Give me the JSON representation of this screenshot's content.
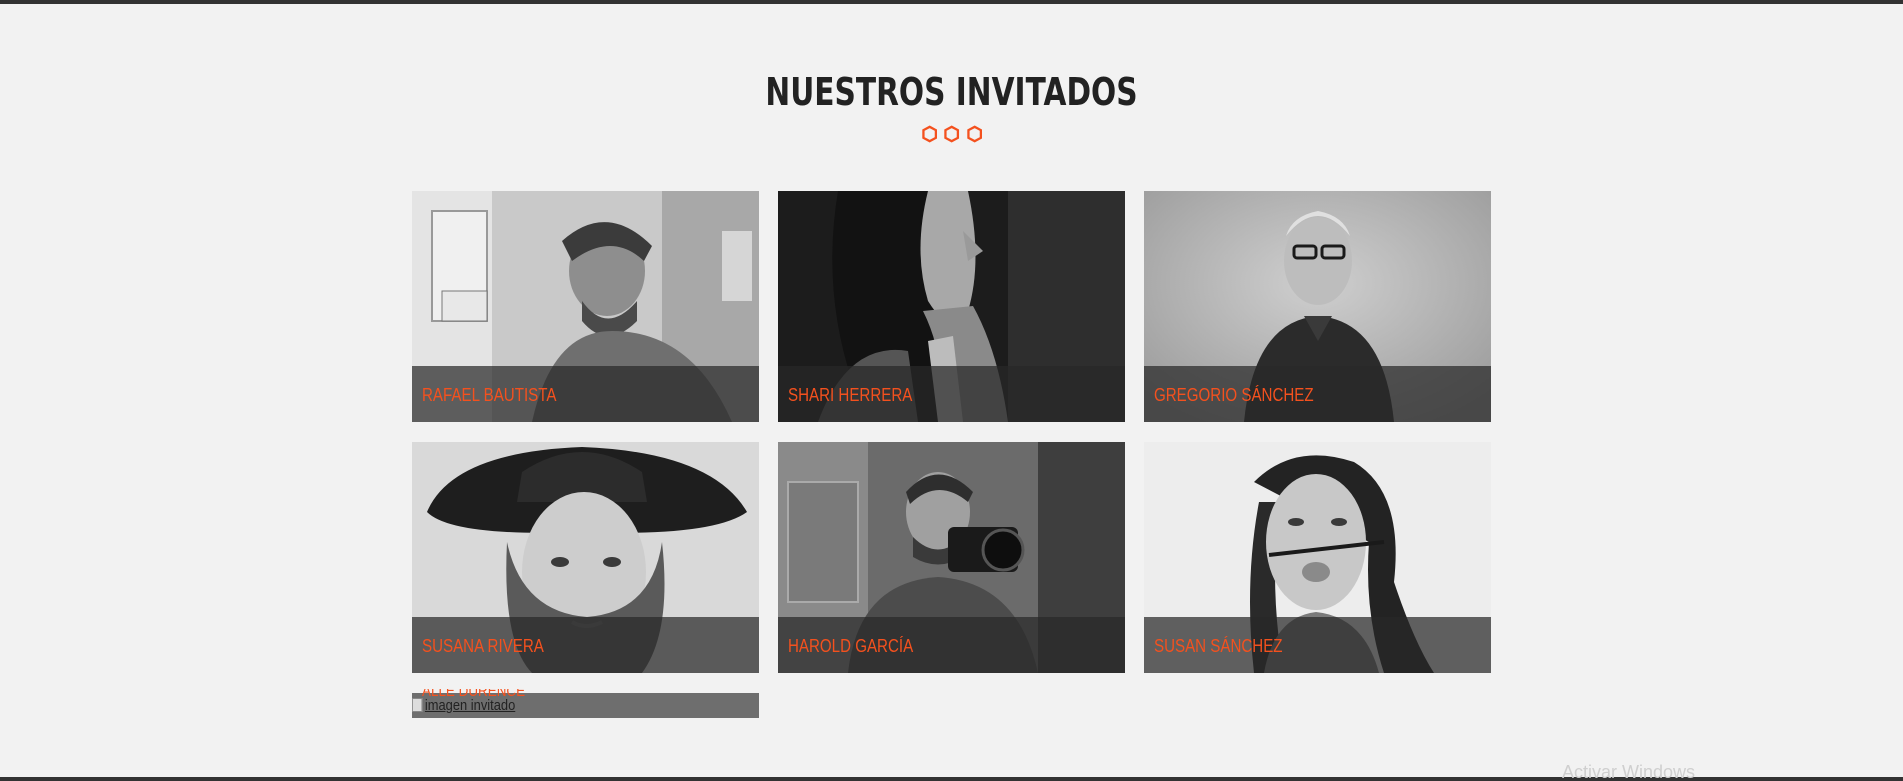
{
  "section": {
    "title": "NUESTROS INVITADOS"
  },
  "decoration": {
    "icon": "hexagon-icon",
    "count": 3,
    "color": "#f4511e"
  },
  "guests": [
    {
      "name": "RAFAEL BAUTISTA",
      "photo": "man-at-computer-photo"
    },
    {
      "name": "SHARI HERRERA",
      "photo": "woman-profile-photo"
    },
    {
      "name": "GREGORIO SÁNCHEZ",
      "photo": "man-with-glasses-photo"
    },
    {
      "name": "SUSANA RIVERA",
      "photo": "woman-with-hat-photo"
    },
    {
      "name": "HAROLD GARCÍA",
      "photo": "photographer-photo"
    },
    {
      "name": "SUSAN SÁNCHEZ",
      "photo": "woman-with-pencil-photo"
    }
  ],
  "broken_item": {
    "name": "ALLE DURENCE",
    "alt_text": "imagen invitado"
  },
  "os_watermark": "Activar Windows",
  "colors": {
    "background": "#f2f2f2",
    "accent": "#f4511e",
    "title": "#222222",
    "caption_overlay": "rgba(40,40,40,0.72)"
  }
}
